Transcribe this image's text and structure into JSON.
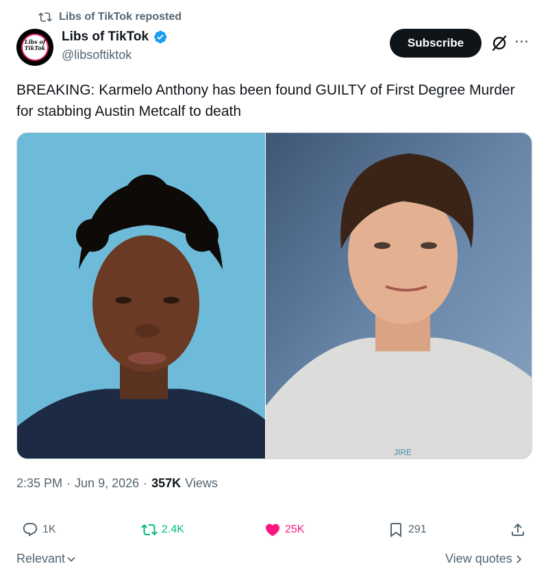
{
  "repost": {
    "label": "Libs of TikTok reposted",
    "icon": "repost-icon"
  },
  "author": {
    "avatar_text": "Libs of TikTok",
    "name": "Libs of TikTok",
    "handle": "@libsoftiktok",
    "verified_icon": "verified-badge-icon"
  },
  "header": {
    "subscribe_label": "Subscribe",
    "grok_icon": "grok-icon",
    "more_icon": "more-icon",
    "more_glyph": "···"
  },
  "tweet": {
    "text": "BREAKING: Karmelo Anthony has been found GUILTY of First Degree Murder for stabbing Austin Metcalf to death",
    "time": "2:35 PM",
    "sep1": "·",
    "date": "Jun 9, 2026",
    "sep2": "·",
    "views_count": "357K",
    "views_label": "Views"
  },
  "media": {
    "left_photo": "mugshot-photo",
    "right_photo": "school-portrait-photo"
  },
  "actions": {
    "replies": "1K",
    "reposts": "2.4K",
    "likes": "25K",
    "bookmarks": "291"
  },
  "footer": {
    "sort_label": "Relevant",
    "view_quotes_label": "View quotes"
  },
  "colors": {
    "text_primary": "#0f1419",
    "text_secondary": "#536471",
    "repost_green": "#00ba7c",
    "like_pink": "#f91880",
    "verified_blue": "#1d9bf0"
  }
}
